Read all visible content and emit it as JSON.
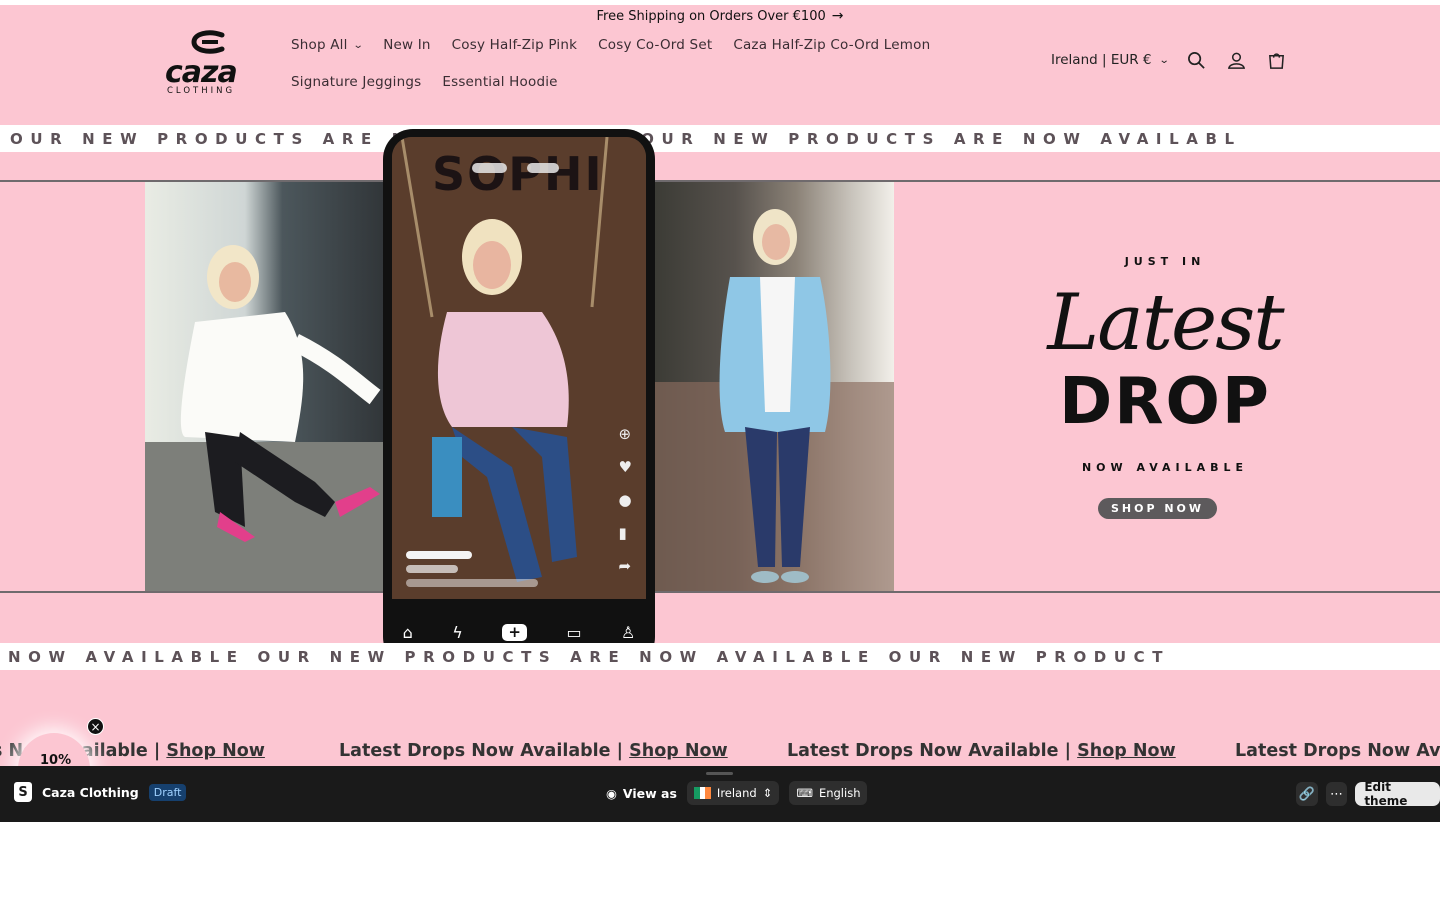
{
  "announcement": {
    "text": "Free Shipping on Orders Over €100",
    "arrow": "→"
  },
  "logo": {
    "word": "caza",
    "sub": "CLOTHING"
  },
  "nav": {
    "row1": [
      "Shop All",
      "New In",
      "Cosy Half-Zip Pink",
      "Cosy Co-Ord Set",
      "Caza Half-Zip Co-Ord Lemon"
    ],
    "row2": [
      "Signature Jeggings",
      "Essential Hoodie"
    ]
  },
  "header": {
    "country": "Ireland | EUR €",
    "icons": [
      "search-icon",
      "account-icon",
      "cart-icon"
    ]
  },
  "marquee": {
    "top": "OUR NEW PRODUCTS ARE NOW AVAILABLE OUR NEW PRODUCTS ARE NOW AVAILABL",
    "bottom": "NOW AVAILABLE OUR NEW PRODUCTS ARE NOW AVAILABLE OUR NEW PRODUCT"
  },
  "phone": {
    "screen_text": "SOPHI"
  },
  "promo": {
    "eyebrow": "JUST IN",
    "script": "Latest",
    "headline": "DROP",
    "subline": "NOW AVAILABLE",
    "button": "SHOP NOW"
  },
  "ticker": {
    "items": [
      {
        "text": "s Now Available | ",
        "link": "Shop Now"
      },
      {
        "text": "Latest Drops Now Available | ",
        "link": "Shop Now"
      },
      {
        "text": "Latest Drops Now Available | ",
        "link": "Shop Now"
      },
      {
        "text": "Latest Drops Now Ava",
        "link": ""
      }
    ]
  },
  "discount_badge": {
    "label": "10%",
    "close": "×"
  },
  "admin_bar": {
    "store_name": "Caza Clothing",
    "status": "Draft",
    "view_as": "View as",
    "market": "Ireland",
    "language": "English",
    "edit_button": "Edit theme"
  },
  "colors": {
    "brand_pink": "#fcc6d2",
    "admin_bg": "#1a1a1a",
    "draft_badge": "#16406e"
  }
}
